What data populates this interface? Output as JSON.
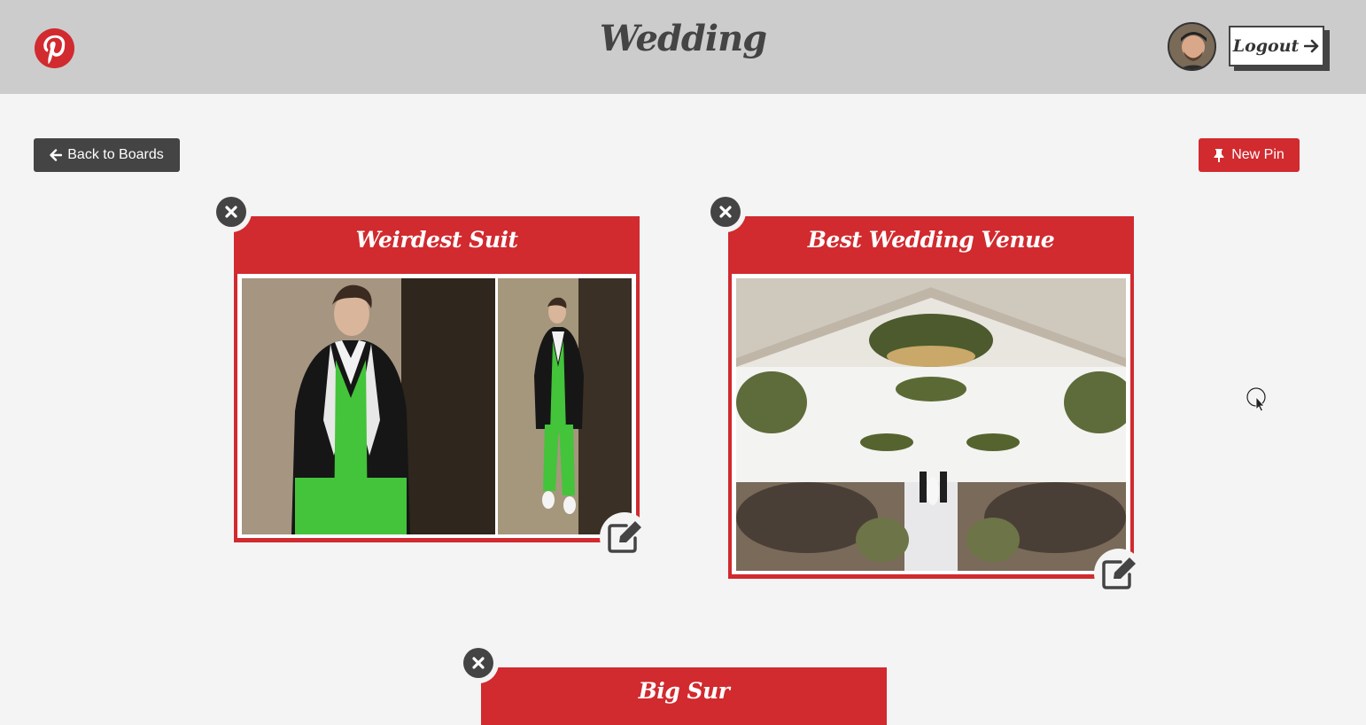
{
  "header": {
    "title": "Wedding",
    "logout_label": "Logout",
    "logo_icon": "pinterest-logo-icon",
    "avatar_icon": "user-avatar"
  },
  "toolbar": {
    "back_label": "Back to Boards",
    "new_pin_label": "New Pin"
  },
  "pins": [
    {
      "title": "Weirdest Suit"
    },
    {
      "title": "Best Wedding Venue"
    },
    {
      "title": "Big Sur"
    }
  ],
  "colors": {
    "header_bg": "#cccccc",
    "page_bg": "#f4f4f4",
    "brand_red": "#d12a2f",
    "dark": "#444444"
  }
}
